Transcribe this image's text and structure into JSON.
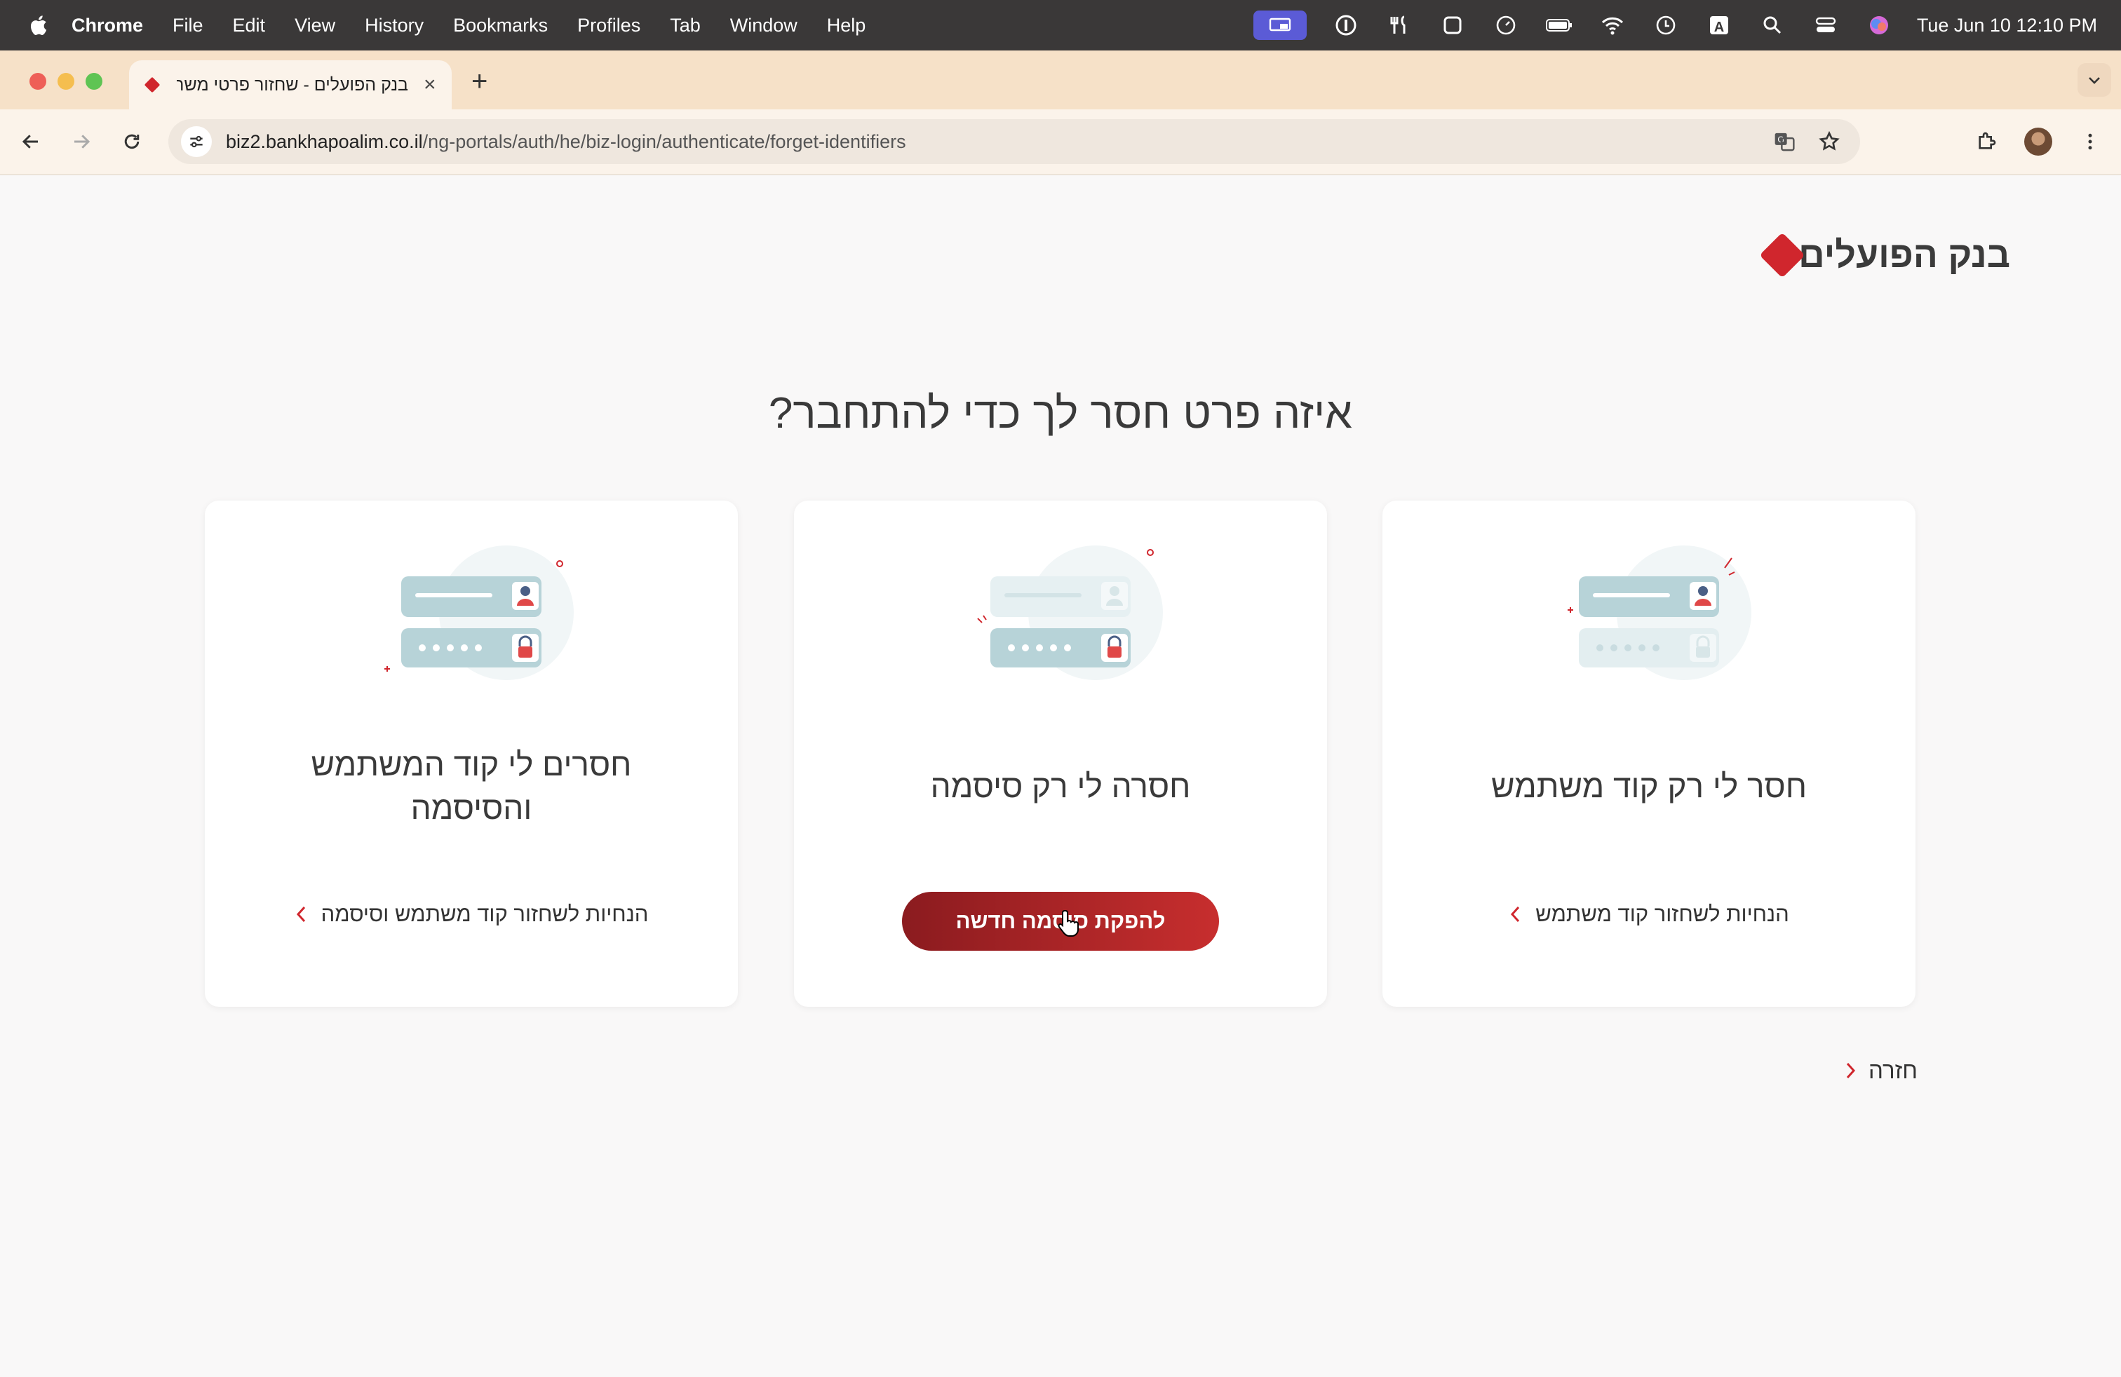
{
  "menubar": {
    "app_name": "Chrome",
    "items": [
      "File",
      "Edit",
      "View",
      "History",
      "Bookmarks",
      "Profiles",
      "Tab",
      "Window",
      "Help"
    ],
    "clock": "Tue Jun 10  12:10 PM"
  },
  "browser": {
    "tab_title": "בנק הפועלים - שחזור פרטי משתמש",
    "url_host": "biz2.bankhapoalim.co.il",
    "url_path": "/ng-portals/auth/he/biz-login/authenticate/forget-identifiers"
  },
  "page": {
    "brand": "בנק הפועלים",
    "title": "איזה פרט חסר לך כדי להתחבר?",
    "cards": [
      {
        "title": "חסר לי רק קוד משתמש",
        "action": "הנחיות לשחזור קוד משתמש"
      },
      {
        "title": "חסרה לי רק סיסמה",
        "action": "להפקת סיסמה חדשה"
      },
      {
        "title": "חסרים לי קוד המשתמש והסיסמה",
        "action": "הנחיות לשחזור קוד משתמש וסיסמה"
      }
    ],
    "back": "חזרה"
  },
  "colors": {
    "brand_red": "#d0262d",
    "button_gradient_start": "#8b1b1f",
    "button_gradient_end": "#c72e2e",
    "tabstrip": "#f6e1c8"
  }
}
